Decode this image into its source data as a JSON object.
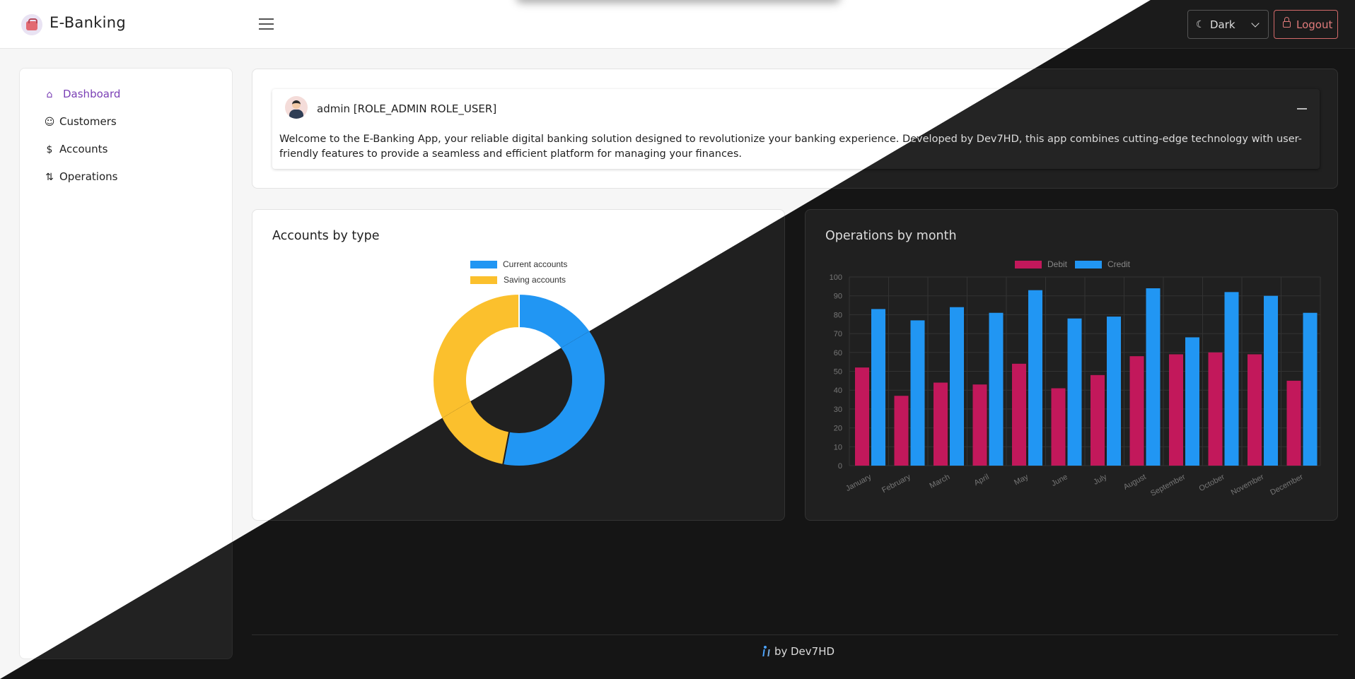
{
  "app": {
    "title": "E-Banking"
  },
  "header": {
    "theme_value": "Dark",
    "logout_label": "Logout"
  },
  "sidebar": {
    "items": [
      {
        "label": "Dashboard",
        "icon": "home-icon",
        "active": true
      },
      {
        "label": "Customers",
        "icon": "person-icon",
        "active": false
      },
      {
        "label": "Accounts",
        "icon": "dollar-icon",
        "active": false
      },
      {
        "label": "Operations",
        "icon": "arrows-up-down-icon",
        "active": false
      }
    ]
  },
  "welcome": {
    "user": "admin [ROLE_ADMIN ROLE_USER]",
    "text": "Welcome to the E-Banking App, your reliable digital banking solution designed to revolutionize your banking experience. Developed by Dev7HD, this app combines cutting-edge technology with user-friendly features to provide a seamless and efficient platform for managing your finances."
  },
  "accounts_card": {
    "title": "Accounts by type"
  },
  "operations_card": {
    "title": "Operations by month"
  },
  "footer": {
    "by": "by",
    "name": "Dev7HD"
  },
  "colors": {
    "accent": "#7a3fb5",
    "current": "#2196f3",
    "saving": "#fbc02d",
    "debit": "#c2185b",
    "credit": "#2196f3",
    "logout": "#e07b7b"
  },
  "chart_data": [
    {
      "type": "pie",
      "title": "Accounts by type",
      "categories": [
        "Current accounts",
        "Saving accounts"
      ],
      "values": [
        53,
        47
      ],
      "colors": [
        "#2196f3",
        "#fbc02d"
      ],
      "legend": "top"
    },
    {
      "type": "bar",
      "title": "Operations by month",
      "categories": [
        "January",
        "February",
        "March",
        "April",
        "May",
        "June",
        "July",
        "August",
        "September",
        "October",
        "November",
        "December"
      ],
      "series": [
        {
          "name": "Debit",
          "color": "#c2185b",
          "values": [
            52,
            37,
            44,
            43,
            54,
            41,
            48,
            58,
            59,
            60,
            59,
            45
          ]
        },
        {
          "name": "Credit",
          "color": "#2196f3",
          "values": [
            83,
            77,
            84,
            81,
            93,
            78,
            79,
            94,
            68,
            92,
            90,
            81
          ]
        }
      ],
      "ylim": [
        0,
        100
      ],
      "yticks": [
        0,
        10,
        20,
        30,
        40,
        50,
        60,
        70,
        80,
        90,
        100
      ],
      "grid": true,
      "legend": "top"
    }
  ]
}
